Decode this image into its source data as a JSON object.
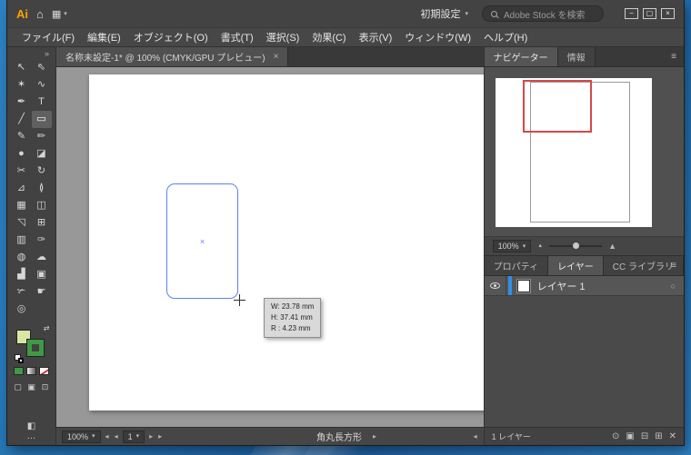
{
  "colors": {
    "logo-orange": "#ffa200",
    "selection-blue": "#5e7ef7",
    "view-red": "#d64848",
    "layer-blue": "#2f8fe8",
    "fill-swatch": "#d9e6a4",
    "stroke-swatch": "#3e9a44"
  },
  "icons": {
    "caret": "▾",
    "panel_menu": "≡",
    "nav_first": "◂",
    "nav_prev": "◂",
    "nav_next": "▸",
    "nav_last": "▸",
    "scroll_right": "▸",
    "scroll_left": "◂",
    "mountain": "▲",
    "circle": "○"
  },
  "titlebar": {
    "logo": "Ai",
    "home_icon": "⌂",
    "arrange_icon": "▦",
    "workspace": "初期設定",
    "search_placeholder": "Adobe Stock を検索",
    "minimize_icon": "−",
    "maximize_icon": "▢",
    "close_icon": "×"
  },
  "menubar": {
    "items": [
      "ファイル(F)",
      "編集(E)",
      "オブジェクト(O)",
      "書式(T)",
      "選択(S)",
      "効果(C)",
      "表示(V)",
      "ウィンドウ(W)",
      "ヘルプ(H)"
    ]
  },
  "toolbar": {
    "collapse_icon": "»",
    "swap_icon": "⇄",
    "screen_mode_icon": "◧",
    "more_icon": "…",
    "tools": [
      {
        "name": "selection-tool",
        "glyph": "↖"
      },
      {
        "name": "direct-selection-tool",
        "glyph": "⇖"
      },
      {
        "name": "magic-wand-tool",
        "glyph": "✶"
      },
      {
        "name": "lasso-tool",
        "glyph": "∿"
      },
      {
        "name": "pen-tool",
        "glyph": "✒"
      },
      {
        "name": "type-tool",
        "glyph": "T"
      },
      {
        "name": "line-segment-tool",
        "glyph": "╱"
      },
      {
        "name": "rounded-rectangle-tool",
        "glyph": "▭",
        "active": true
      },
      {
        "name": "paintbrush-tool",
        "glyph": "✎"
      },
      {
        "name": "pencil-tool",
        "glyph": "✏"
      },
      {
        "name": "blob-brush-tool",
        "glyph": "●"
      },
      {
        "name": "eraser-tool",
        "glyph": "◪"
      },
      {
        "name": "scissors-tool",
        "glyph": "✂"
      },
      {
        "name": "rotate-tool",
        "glyph": "↻"
      },
      {
        "name": "scale-tool",
        "glyph": "⊿"
      },
      {
        "name": "width-tool",
        "glyph": "≬"
      },
      {
        "name": "free-transform-tool",
        "glyph": "▦"
      },
      {
        "name": "shape-builder-tool",
        "glyph": "◫"
      },
      {
        "name": "perspective-grid-tool",
        "glyph": "◹"
      },
      {
        "name": "mesh-tool",
        "glyph": "⊞"
      },
      {
        "name": "gradient-tool",
        "glyph": "▥"
      },
      {
        "name": "eyedropper-tool",
        "glyph": "✑"
      },
      {
        "name": "blend-tool",
        "glyph": "◍"
      },
      {
        "name": "symbol-sprayer-tool",
        "glyph": "☁"
      },
      {
        "name": "column-graph-tool",
        "glyph": "▟"
      },
      {
        "name": "artboard-tool",
        "glyph": "▣"
      },
      {
        "name": "slice-tool",
        "glyph": "✃"
      },
      {
        "name": "hand-tool",
        "glyph": "☛"
      },
      {
        "name": "zoom-tool",
        "glyph": "◎"
      }
    ],
    "draw_modes": [
      {
        "name": "draw-normal-button",
        "glyph": "▢"
      },
      {
        "name": "draw-behind-button",
        "glyph": "▣"
      },
      {
        "name": "draw-inside-button",
        "glyph": "⊡"
      }
    ]
  },
  "document": {
    "tab_title": "名称未設定-1* @ 100% (CMYK/GPU プレビュー)",
    "close_icon": "×",
    "status": {
      "zoom": "100%",
      "page": "1",
      "tool_name": "角丸長方形"
    }
  },
  "canvas": {
    "center_mark": "×",
    "tooltip_lines": [
      "W: 23.78 mm",
      "H: 37.41 mm",
      "R : 4.23 mm"
    ]
  },
  "panels": {
    "navigator": {
      "tabs": [
        {
          "name": "tab-navigator",
          "label": "ナビゲーター",
          "active": true
        },
        {
          "name": "tab-info",
          "label": "情報"
        }
      ],
      "zoom": "100%"
    },
    "layers": {
      "tabs": [
        {
          "name": "tab-properties",
          "label": "プロパティ"
        },
        {
          "name": "tab-layers",
          "label": "レイヤー",
          "active": true
        },
        {
          "name": "tab-cc-libraries",
          "label": "CC ライブラリ"
        }
      ],
      "layer_name": "レイヤー 1",
      "count_label": "1 レイヤー",
      "footer_icons": [
        {
          "name": "locate-object-icon",
          "glyph": "⊙"
        },
        {
          "name": "make-clipping-mask-icon",
          "glyph": "▣"
        },
        {
          "name": "new-sublayer-icon",
          "glyph": "⊟"
        },
        {
          "name": "new-layer-icon",
          "glyph": "⊞"
        },
        {
          "name": "delete-layer-icon",
          "glyph": "✕"
        }
      ]
    }
  }
}
